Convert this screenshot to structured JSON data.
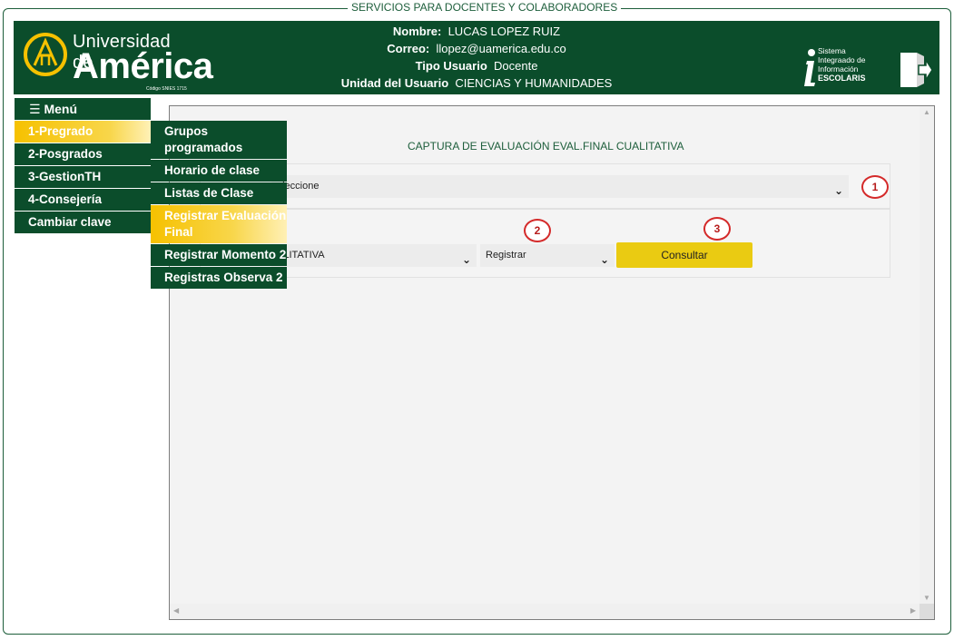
{
  "frame": {
    "title": "SERVICIOS PARA DOCENTES Y COLABORADORES"
  },
  "header": {
    "logo_line1": "Universidad de",
    "logo_line2": "América",
    "logo_code": "Código SNIES 1715",
    "user": {
      "name_label": "Nombre:",
      "name_value": "LUCAS LOPEZ RUIZ",
      "email_label": "Correo:",
      "email_value": "llopez@uamerica.edu.co",
      "type_label": "Tipo Usuario",
      "type_value": "Docente",
      "unit_label": "Unidad del Usuario",
      "unit_value": "CIENCIAS Y HUMANIDADES"
    },
    "escolaris": {
      "line1": "Sistema",
      "line2": "Integraado de",
      "line3": "Información",
      "line4": "ESCOLARIS"
    }
  },
  "nav": {
    "menu_label": "☰ Menú",
    "items": [
      {
        "label": "1-Pregrado"
      },
      {
        "label": "2-Posgrados"
      },
      {
        "label": "3-GestionTH"
      },
      {
        "label": "4-Consejería"
      },
      {
        "label": "Cambiar clave"
      }
    ]
  },
  "submenu": {
    "items": [
      {
        "label": "Grupos programados"
      },
      {
        "label": "Horario de clase"
      },
      {
        "label": "Listas de Clase"
      },
      {
        "label": "Registrar Evaluación Final"
      },
      {
        "label": "Registrar Momento 2"
      },
      {
        "label": "Registras Observa 2"
      }
    ]
  },
  "form": {
    "title": "CAPTURA DE EVALUACIÓN EVAL.FINAL CUALITATIVA",
    "select_group": "eleccione",
    "select_type": "ALITATIVA",
    "select_action": "Registrar",
    "consultar_label": "Consultar",
    "badges": [
      "1",
      "2",
      "3"
    ]
  },
  "colors": {
    "brand_green": "#0b4d2b",
    "accent_gold": "#f6c100",
    "button_yellow": "#eacb12",
    "badge_red": "#d42a2a"
  }
}
